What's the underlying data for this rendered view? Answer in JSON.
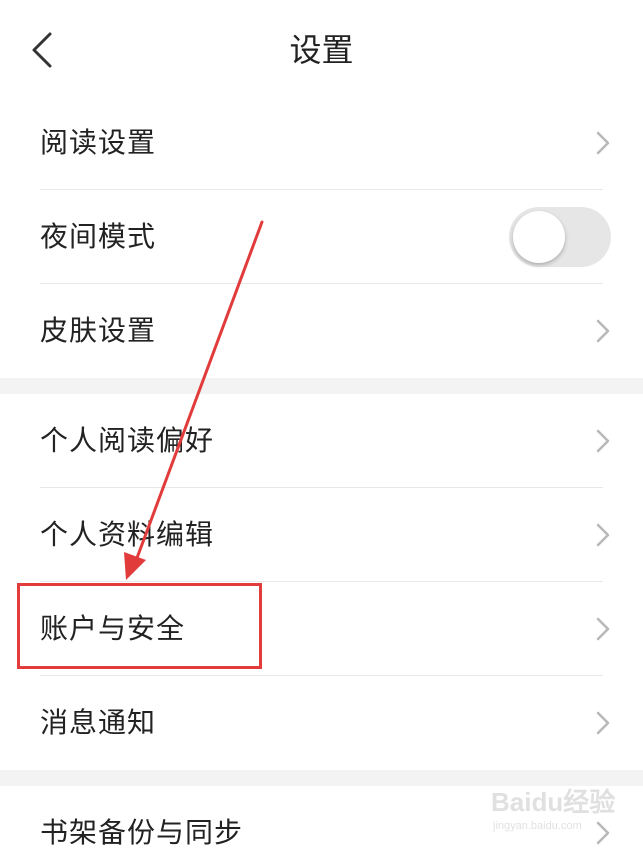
{
  "header": {
    "title": "设置"
  },
  "section1": {
    "items": [
      {
        "label": "阅读设置"
      },
      {
        "label": "夜间模式"
      },
      {
        "label": "皮肤设置"
      }
    ]
  },
  "section2": {
    "items": [
      {
        "label": "个人阅读偏好"
      },
      {
        "label": "个人资料编辑"
      },
      {
        "label": "账户与安全"
      },
      {
        "label": "消息通知"
      }
    ]
  },
  "section3": {
    "items": [
      {
        "label": "书架备份与同步"
      }
    ]
  },
  "night_mode": {
    "enabled": false
  },
  "watermark": {
    "text": "Baidu经验",
    "subtext": "jingyan.baidu.com"
  },
  "colors": {
    "annotation_red": "#e23b3b",
    "divider": "#e8e8e8",
    "section_gap": "#f3f3f3",
    "toggle_off": "#e6e6e6"
  }
}
